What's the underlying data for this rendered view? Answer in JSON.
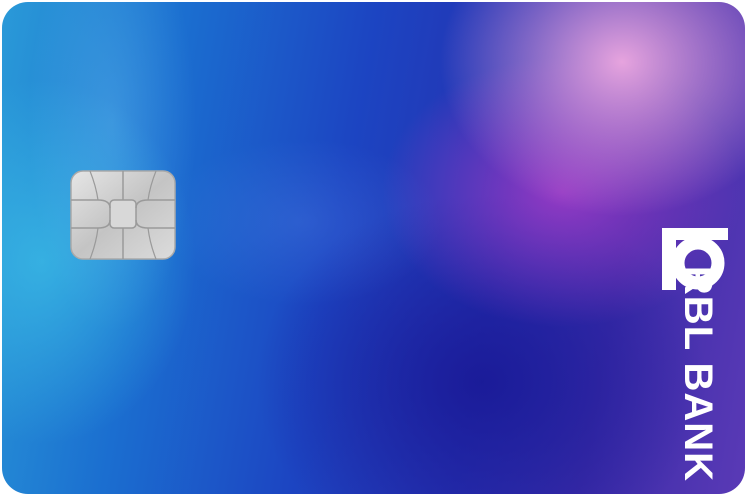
{
  "card": {
    "brand_text": "RBL BANK",
    "logo_icon": "rbl-b-logo-icon",
    "chip_icon": "emv-chip-icon",
    "colors": {
      "blue_left": "#2a9ad8",
      "blue_mid": "#1c45c2",
      "purple": "#a53cc8",
      "pink": "#f0aae1",
      "chip_silver": "#c9c9c9",
      "text": "#ffffff"
    }
  }
}
